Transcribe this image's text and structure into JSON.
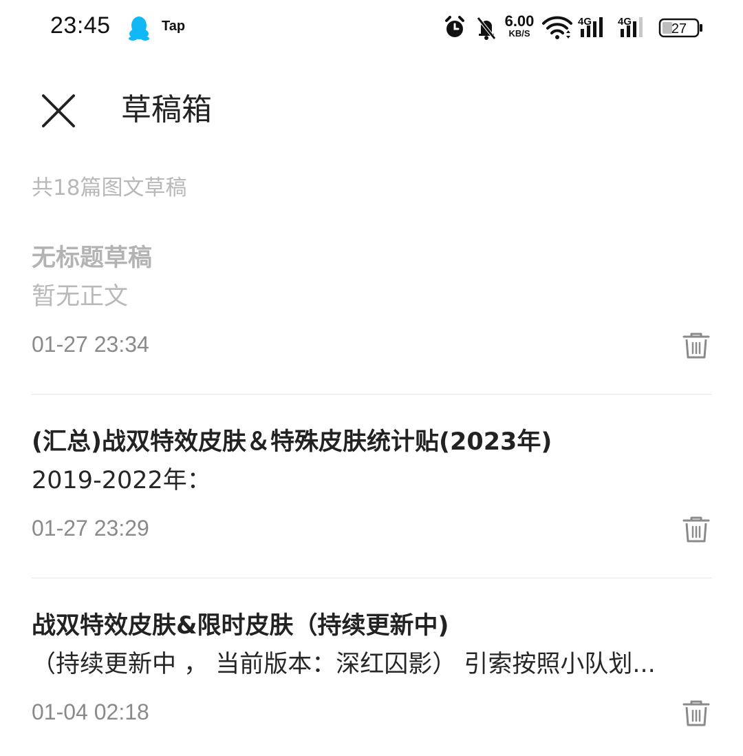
{
  "status_bar": {
    "time": "23:45",
    "app_badge": "Tap",
    "net_speed_value": "6.00",
    "net_speed_unit": "KB/S",
    "sim1_label": "4G",
    "sim2_label": "4G",
    "battery_level": "27",
    "icons": [
      "qq-penguin-icon",
      "alarm-icon",
      "bell-muted-icon",
      "wifi-icon",
      "signal-icon",
      "battery-icon"
    ]
  },
  "header": {
    "title": "草稿箱",
    "close_icon": "close-icon"
  },
  "summary": {
    "text": "共18篇图文草稿"
  },
  "drafts": [
    {
      "title": "无标题草稿",
      "body": "暂无正文",
      "time": "01-27 23:34",
      "untitled": true
    },
    {
      "title": "(汇总)战双特效皮肤＆特殊皮肤统计贴(2023年)",
      "body": "2019-2022年：",
      "time": "01-27 23:29",
      "untitled": false
    },
    {
      "title": "战双特效皮肤&限时皮肤（持续更新中)",
      "body": "（持续更新中 ， 当前版本：深红囚影） 引索按照小队划...",
      "time": "01-04 02:18",
      "untitled": false
    }
  ],
  "colors": {
    "primary_text": "#222222",
    "muted_text": "#b3b3b3",
    "timestamp": "#8a8a8a",
    "divider": "#e6e6e6",
    "qq_blue": "#12b7f5"
  }
}
